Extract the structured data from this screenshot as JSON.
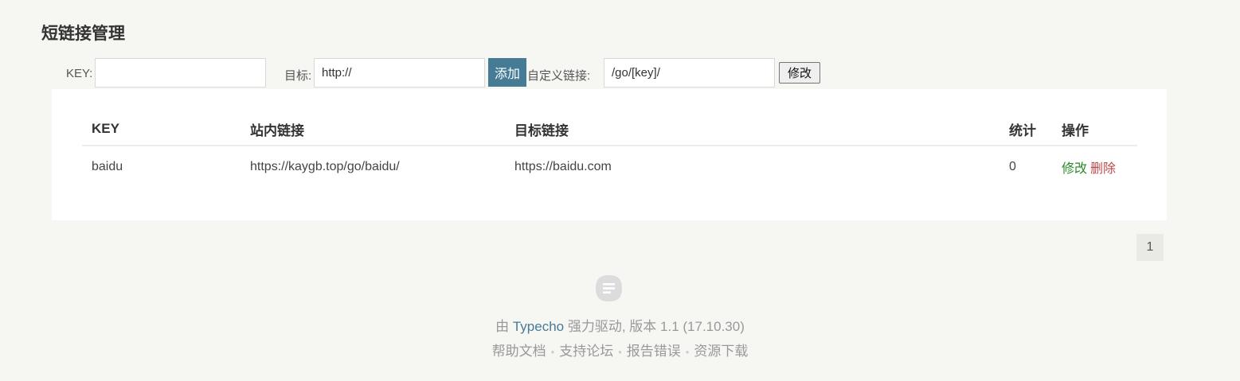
{
  "page": {
    "title": "短链接管理"
  },
  "form": {
    "key_label": "KEY:",
    "key_value": "",
    "target_label": "目标:",
    "target_value": "http://",
    "add_button": "添加",
    "custom_label": "自定义链接:",
    "custom_value": "/go/[key]/",
    "edit_button": "修改"
  },
  "table": {
    "headers": [
      "KEY",
      "站内链接",
      "目标链接",
      "统计",
      "操作"
    ],
    "rows": [
      {
        "key": "baidu",
        "site_link": "https://kaygb.top/go/baidu/",
        "target_link": "https://baidu.com",
        "count": "0",
        "edit": "修改",
        "delete": "删除"
      }
    ]
  },
  "pagination": {
    "current": "1"
  },
  "footer": {
    "prefix": "由",
    "brand": "Typecho",
    "suffix": "强力驱动, 版本 1.1 (17.10.30)",
    "links": [
      "帮助文档",
      "支持论坛",
      "报告错误",
      "资源下载"
    ],
    "separator": "•"
  },
  "colors": {
    "accent": "#467b96",
    "background": "#f6f6f3",
    "edit_link": "#2a8a2a",
    "delete_link": "#b94a48"
  },
  "icons": {
    "footer_logo": "typecho-logo-icon"
  }
}
